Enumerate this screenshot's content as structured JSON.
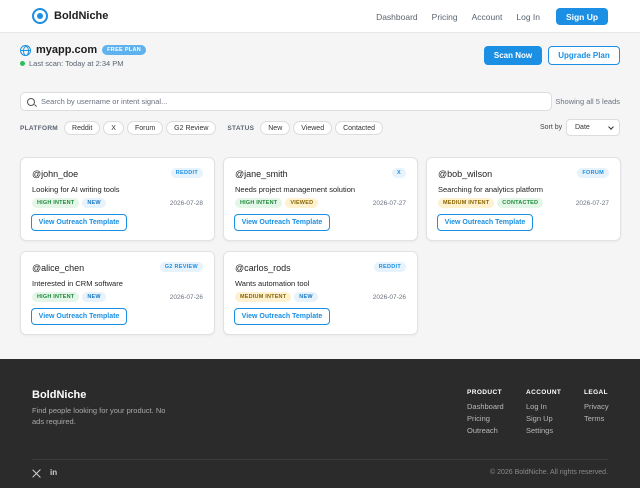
{
  "nav": {
    "brand": "BoldNiche",
    "links": [
      "Dashboard",
      "Pricing",
      "Account",
      "Log In"
    ],
    "signup": "Sign Up"
  },
  "site": {
    "name": "myapp.com",
    "plan": "FREE PLAN",
    "last_scan": "Last scan: Today at 2:34 PM",
    "status_color": "#2ebd59"
  },
  "actions": {
    "scan": "Scan Now",
    "upgrade": "Upgrade Plan"
  },
  "search": {
    "placeholder": "Search by username or intent signal...",
    "showing": "Showing all 5 leads"
  },
  "filters": {
    "platform_title": "PLATFORM",
    "platforms": [
      "Reddit",
      "X",
      "Forum",
      "G2 Review"
    ],
    "status_title": "STATUS",
    "statuses": [
      "New",
      "Viewed",
      "Contacted"
    ],
    "sort_label": "Sort by",
    "sort_value": "Date"
  },
  "leads": [
    {
      "user": "@john_doe",
      "source": "REDDIT",
      "need": "Looking for AI writing tools",
      "intent": "HIGH INTENT",
      "intent_class": "high",
      "status": "NEW",
      "status_class": "new",
      "date": "2026-07-28",
      "button": "View Outreach Template"
    },
    {
      "user": "@jane_smith",
      "source": "X",
      "need": "Needs project management solution",
      "intent": "HIGH INTENT",
      "intent_class": "high",
      "status": "VIEWED",
      "status_class": "viewed",
      "date": "2026-07-27",
      "button": "View Outreach Template"
    },
    {
      "user": "@bob_wilson",
      "source": "FORUM",
      "need": "Searching for analytics platform",
      "intent": "MEDIUM INTENT",
      "intent_class": "medium",
      "status": "CONTACTED",
      "status_class": "contacted",
      "date": "2026-07-27",
      "button": "View Outreach Template"
    },
    {
      "user": "@alice_chen",
      "source": "G2 REVIEW",
      "need": "Interested in CRM software",
      "intent": "HIGH INTENT",
      "intent_class": "high",
      "status": "NEW",
      "status_class": "new",
      "date": "2026-07-26",
      "button": "View Outreach Template"
    },
    {
      "user": "@carlos_rods",
      "source": "REDDIT",
      "need": "Wants automation tool",
      "intent": "MEDIUM INTENT",
      "intent_class": "medium",
      "status": "NEW",
      "status_class": "new",
      "date": "2026-07-26",
      "button": "View Outreach Template"
    }
  ],
  "footer": {
    "brand": "BoldNiche",
    "tagline": "Find people looking for your product. No ads required.",
    "columns": [
      {
        "title": "PRODUCT",
        "links": [
          "Dashboard",
          "Pricing",
          "Outreach"
        ]
      },
      {
        "title": "ACCOUNT",
        "links": [
          "Log In",
          "Sign Up",
          "Settings"
        ]
      },
      {
        "title": "LEGAL",
        "links": [
          "Privacy",
          "Terms"
        ]
      }
    ],
    "social": [
      "x-icon",
      "linkedin-icon"
    ],
    "linkedin_glyph": "in",
    "copyright": "© 2026 BoldNiche. All rights reserved."
  },
  "colors": {
    "accent": "#1a8fe3",
    "footer_bg": "#2b2b2b"
  }
}
